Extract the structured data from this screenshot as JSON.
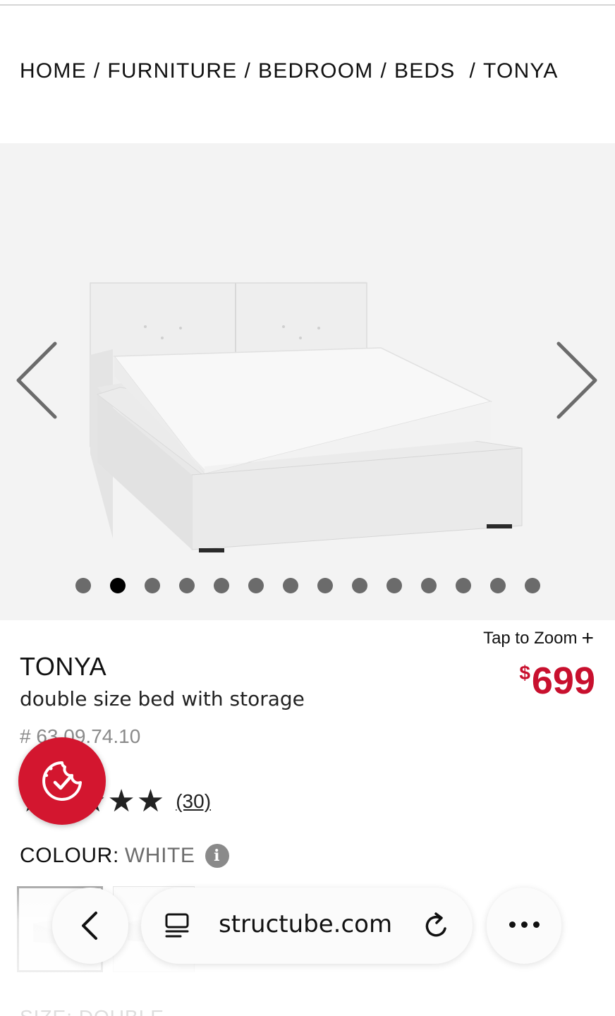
{
  "breadcrumb": {
    "items": [
      "HOME",
      "FURNITURE",
      "BEDROOM",
      "BEDS",
      "TONYA"
    ],
    "separator": "/"
  },
  "gallery": {
    "image_count": 14,
    "active_index": 1,
    "prev_icon": "chevron-left-icon",
    "next_icon": "chevron-right-icon"
  },
  "zoom": {
    "label": "Tap to Zoom",
    "icon": "+"
  },
  "product": {
    "name": "TONYA",
    "description": "double size bed with storage",
    "sku": "# 63.09.74.10",
    "price_currency": "$",
    "price_amount": "699",
    "rating_stars": "★★★★★",
    "rating_value": 5,
    "review_count": "(30)"
  },
  "colour": {
    "label": "COLOUR:",
    "value": "WHITE",
    "info_icon": "i"
  },
  "size_peek": "SIZE: DOUBLE",
  "browser": {
    "url": "structube.com",
    "back_icon": "chevron-left-icon",
    "reader_icon": "reader-mode-icon",
    "reload_icon": "reload-icon",
    "more_icon": "more-dots-icon"
  },
  "colors": {
    "price_red": "#c8102e",
    "cookie_fab": "#d3162f",
    "gallery_bg": "#f3f3f3"
  }
}
